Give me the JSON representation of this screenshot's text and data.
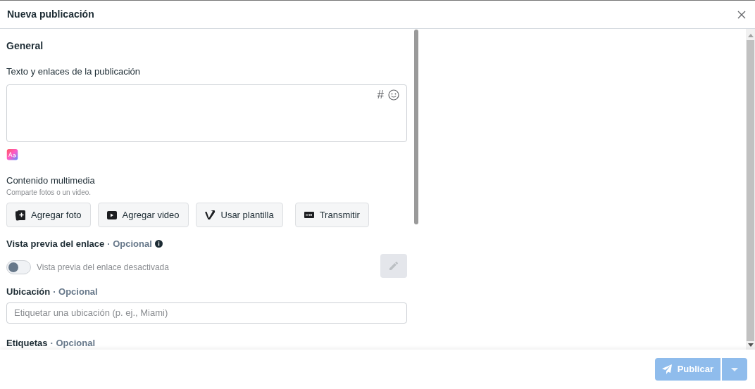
{
  "window": {
    "title": "Nueva publicación"
  },
  "section": {
    "title": "General"
  },
  "post_text": {
    "label": "Texto y enlaces de la publicación",
    "tools": [
      "#"
    ]
  },
  "media": {
    "label": "Contenido multimedia",
    "hint": "Comparte fotos o un video.",
    "buttons": [
      {
        "kind": "photo",
        "label": "Agregar foto"
      },
      {
        "kind": "video",
        "label": "Agregar video"
      },
      {
        "kind": "template",
        "label": "Usar plantilla"
      },
      {
        "kind": "live",
        "label": "Transmitir"
      }
    ]
  },
  "link_preview": {
    "label": "Vista previa del enlace",
    "optional": "· Opcional",
    "toggle": {
      "on": false,
      "label": "Vista previa del enlace desactivada"
    }
  },
  "location": {
    "label": "Ubicación",
    "optional": "· Opcional",
    "placeholder": "Etiquetar una ubicación (p. ej., Miami)"
  },
  "tags": {
    "label": "Etiquetas",
    "optional": "· Opcional"
  },
  "footer": {
    "publish": {
      "label": "Publicar",
      "disabled": true
    }
  }
}
